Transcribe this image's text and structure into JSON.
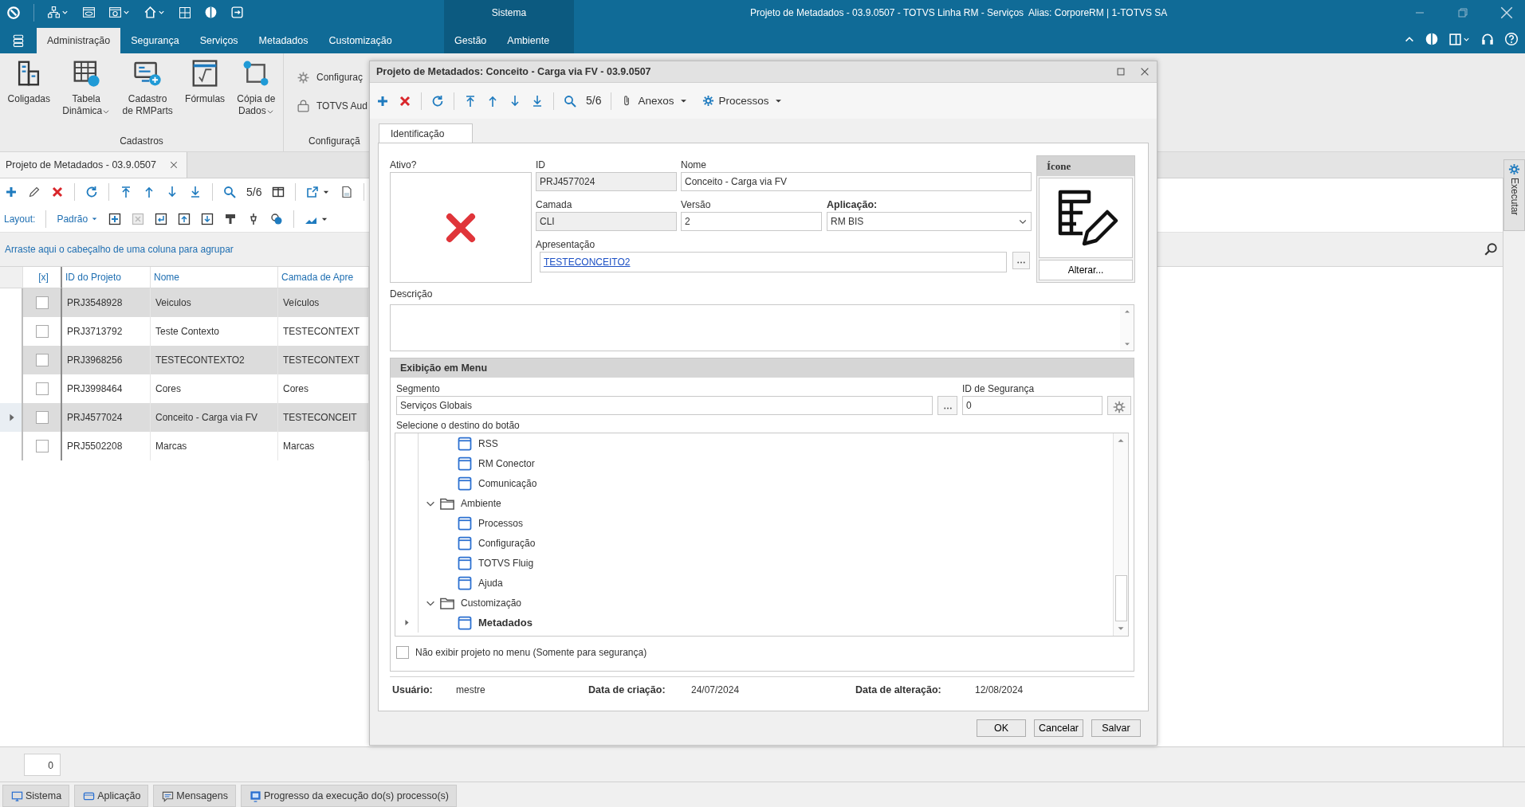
{
  "window": {
    "title": "Projeto de Metadados - 03.9.0507 - TOTVS Linha RM - Serviços  Alias: CorporeRM | 1-TOTVS SA",
    "context_label": "Sistema"
  },
  "ribbon_tabs": [
    {
      "label": "Administração",
      "selected": true,
      "contextual": false
    },
    {
      "label": "Segurança",
      "selected": false,
      "contextual": false
    },
    {
      "label": "Serviços",
      "selected": false,
      "contextual": false
    },
    {
      "label": "Metadados",
      "selected": false,
      "contextual": false
    },
    {
      "label": "Customização",
      "selected": false,
      "contextual": false
    },
    {
      "label": "Gestão",
      "selected": false,
      "contextual": true
    },
    {
      "label": "Ambiente",
      "selected": false,
      "contextual": true
    }
  ],
  "ribbon_groups": [
    {
      "label": "Cadastros",
      "items": [
        {
          "label": "Coligadas",
          "kind": "large",
          "dropdown": false
        },
        {
          "label": "Tabela\nDinâmica",
          "kind": "large",
          "dropdown": true
        },
        {
          "label": "Cadastro\nde RMParts",
          "kind": "large",
          "dropdown": false
        },
        {
          "label": "Fórmulas",
          "kind": "large",
          "dropdown": false
        },
        {
          "label": "Cópia de\nDados",
          "kind": "large",
          "dropdown": true
        }
      ]
    },
    {
      "label": "Configuraçã",
      "items": [
        {
          "label": "Configuraç",
          "kind": "small",
          "dropdown": false
        },
        {
          "label": "TOTVS Aud",
          "kind": "small",
          "dropdown": false
        }
      ]
    }
  ],
  "document_tab": {
    "label": "Projeto de Metadados - 03.9.0507"
  },
  "grid_toolbar": {
    "position": "5/6",
    "layout_label": "Layout:",
    "layout_value": "Padrão"
  },
  "group_hint": "Arraste aqui o cabeçalho de uma coluna para agrupar",
  "grid": {
    "check_column": "[x]",
    "columns": [
      "ID do Projeto",
      "Nome",
      "Camada de Apre"
    ],
    "rows": [
      {
        "checked": false,
        "selected": false,
        "cells": [
          "PRJ3548928",
          "Veiculos",
          "Veículos"
        ]
      },
      {
        "checked": false,
        "selected": false,
        "cells": [
          "PRJ3713792",
          "Teste Contexto",
          "TESTECONTEXT"
        ]
      },
      {
        "checked": false,
        "selected": false,
        "cells": [
          "PRJ3968256",
          "TESTECONTEXTO2",
          "TESTECONTEXT"
        ]
      },
      {
        "checked": false,
        "selected": false,
        "cells": [
          "PRJ3998464",
          "Cores",
          "Cores"
        ]
      },
      {
        "checked": false,
        "selected": true,
        "cells": [
          "PRJ4577024",
          "Conceito - Carga via FV",
          "TESTECONCEIT"
        ]
      },
      {
        "checked": false,
        "selected": false,
        "cells": [
          "PRJ5502208",
          "Marcas",
          "Marcas"
        ]
      }
    ]
  },
  "record_count": "0",
  "side_panel": {
    "label": "Executar"
  },
  "status_tabs": [
    "Sistema",
    "Aplicação",
    "Mensagens",
    "Progresso da execução do(s) processo(s)"
  ],
  "dialog": {
    "title": "Projeto de Metadados: Conceito - Carga via FV - 03.9.0507",
    "position": "5/6",
    "menus": [
      "Anexos",
      "Processos"
    ],
    "tabs": [
      {
        "label": "Identificação",
        "selected": true
      }
    ],
    "active": {
      "label": "Ativo?",
      "checked": false
    },
    "id_field": {
      "label": "ID",
      "value": "PRJ4577024",
      "disabled": true
    },
    "name_field": {
      "label": "Nome",
      "value": "Conceito - Carga via FV",
      "disabled": false
    },
    "layer_field": {
      "label": "Camada",
      "value": "CLI",
      "disabled": true
    },
    "version_field": {
      "label": "Versão",
      "value": "2",
      "disabled": false
    },
    "application_field": {
      "label": "Aplicação:",
      "value": "RM BIS"
    },
    "presentation_field": {
      "label": "Apresentação",
      "value": "TESTECONCEITO2"
    },
    "icon_panel": {
      "title": "Ícone",
      "button": "Alterar..."
    },
    "description_field": {
      "label": "Descrição"
    },
    "menu_section": {
      "title": "Exibição em Menu",
      "segment": {
        "label": "Segmento",
        "value": "Serviços Globais"
      },
      "security_id": {
        "label": "ID de Segurança",
        "value": "0"
      },
      "tree_label": "Selecione o destino do botão",
      "tree": {
        "continued_children": [
          {
            "label": "RSS",
            "kind": "item",
            "selected": false
          },
          {
            "label": "RM Conector",
            "kind": "item",
            "selected": false
          },
          {
            "label": "Comunicação",
            "kind": "item",
            "selected": false
          }
        ],
        "items": [
          {
            "label": "Ambiente",
            "kind": "folder",
            "expanded": true,
            "selected": false,
            "children": [
              {
                "label": "Processos",
                "kind": "item",
                "selected": false
              },
              {
                "label": "Configuração",
                "kind": "item",
                "selected": false
              },
              {
                "label": "TOTVS Fluig",
                "kind": "item",
                "selected": false
              },
              {
                "label": "Ajuda",
                "kind": "item",
                "selected": false
              }
            ]
          },
          {
            "label": "Customização",
            "kind": "folder",
            "expanded": true,
            "selected": false,
            "children": [
              {
                "label": "Metadados",
                "kind": "item",
                "selected": true
              }
            ]
          }
        ]
      },
      "hide_checkbox": {
        "label": "Não exibir projeto no menu (Somente para segurança)",
        "checked": false
      }
    },
    "footer": [
      {
        "label": "Usuário:",
        "value": "mestre"
      },
      {
        "label": "Data de criação:",
        "value": "24/07/2024"
      },
      {
        "label": "Data de alteração:",
        "value": "12/08/2024"
      }
    ],
    "buttons": [
      "OK",
      "Cancelar",
      "Salvar"
    ]
  }
}
